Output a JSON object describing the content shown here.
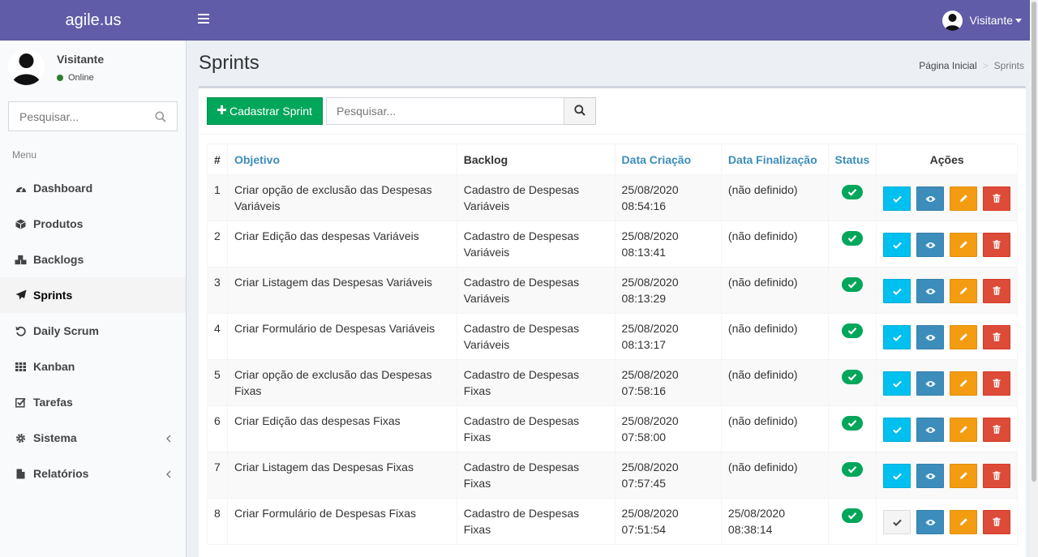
{
  "app": {
    "logo": "agile.us"
  },
  "header": {
    "user_name": "Visitante"
  },
  "sidebar": {
    "user_name": "Visitante",
    "status": "Online",
    "search_placeholder": "Pesquisar...",
    "menu_header": "Menu",
    "items": [
      {
        "label": "Dashboard",
        "icon": "dashboard-icon"
      },
      {
        "label": "Produtos",
        "icon": "cube-icon"
      },
      {
        "label": "Backlogs",
        "icon": "cubes-icon"
      },
      {
        "label": "Sprints",
        "icon": "paper-plane-icon"
      },
      {
        "label": "Daily Scrum",
        "icon": "undo-icon"
      },
      {
        "label": "Kanban",
        "icon": "grid-icon"
      },
      {
        "label": "Tarefas",
        "icon": "check-square-icon"
      },
      {
        "label": "Sistema",
        "icon": "gear-icon"
      },
      {
        "label": "Relatórios",
        "icon": "file-icon"
      }
    ]
  },
  "page": {
    "title": "Sprints",
    "breadcrumb": {
      "home": "Página Inicial",
      "sep": ">",
      "current": "Sprints"
    }
  },
  "toolbar": {
    "add_label": "Cadastrar Sprint",
    "search_placeholder": "Pesquisar..."
  },
  "table": {
    "headers": {
      "num": "#",
      "objetivo": "Objetivo",
      "backlog": "Backlog",
      "data_criacao": "Data Criação",
      "data_finalizacao": "Data Finalização",
      "status": "Status",
      "acoes": "Ações"
    },
    "rows": [
      {
        "num": "1",
        "objetivo": "Criar opção de exclusão das Despesas Variáveis",
        "backlog": "Cadastro de Despesas Variáveis",
        "criacao_date": "25/08/2020",
        "criacao_time": "08:54:16",
        "final_date": "(não definido)",
        "final_time": ""
      },
      {
        "num": "2",
        "objetivo": "Criar Edição das despesas Variáveis",
        "backlog": "Cadastro de Despesas Variáveis",
        "criacao_date": "25/08/2020",
        "criacao_time": "08:13:41",
        "final_date": "(não definido)",
        "final_time": ""
      },
      {
        "num": "3",
        "objetivo": "Criar Listagem das Despesas Variáveis",
        "backlog": "Cadastro de Despesas Variáveis",
        "criacao_date": "25/08/2020",
        "criacao_time": "08:13:29",
        "final_date": "(não definido)",
        "final_time": ""
      },
      {
        "num": "4",
        "objetivo": "Criar Formulário de Despesas Variáveis",
        "backlog": "Cadastro de Despesas Variáveis",
        "criacao_date": "25/08/2020",
        "criacao_time": "08:13:17",
        "final_date": "(não definido)",
        "final_time": ""
      },
      {
        "num": "5",
        "objetivo": "Criar opção de exclusão das Despesas Fixas",
        "backlog": "Cadastro de Despesas Fixas",
        "criacao_date": "25/08/2020",
        "criacao_time": "07:58:16",
        "final_date": "(não definido)",
        "final_time": ""
      },
      {
        "num": "6",
        "objetivo": "Criar Edição das despesas Fixas",
        "backlog": "Cadastro de Despesas Fixas",
        "criacao_date": "25/08/2020",
        "criacao_time": "07:58:00",
        "final_date": "(não definido)",
        "final_time": ""
      },
      {
        "num": "7",
        "objetivo": "Criar Listagem das Despesas Fixas",
        "backlog": "Cadastro de Despesas Fixas",
        "criacao_date": "25/08/2020",
        "criacao_time": "07:57:45",
        "final_date": "(não definido)",
        "final_time": ""
      },
      {
        "num": "8",
        "objetivo": "Criar Formulário de Despesas Fixas",
        "backlog": "Cadastro de Despesas Fixas",
        "criacao_date": "25/08/2020",
        "criacao_time": "07:51:54",
        "final_date": "25/08/2020",
        "final_time": "08:38:14"
      }
    ]
  },
  "colors": {
    "header": "#605ca8",
    "success": "#00a65a",
    "info": "#00c0ef",
    "primary": "#3c8dbc",
    "warning": "#f39c12",
    "danger": "#dd4b39"
  }
}
